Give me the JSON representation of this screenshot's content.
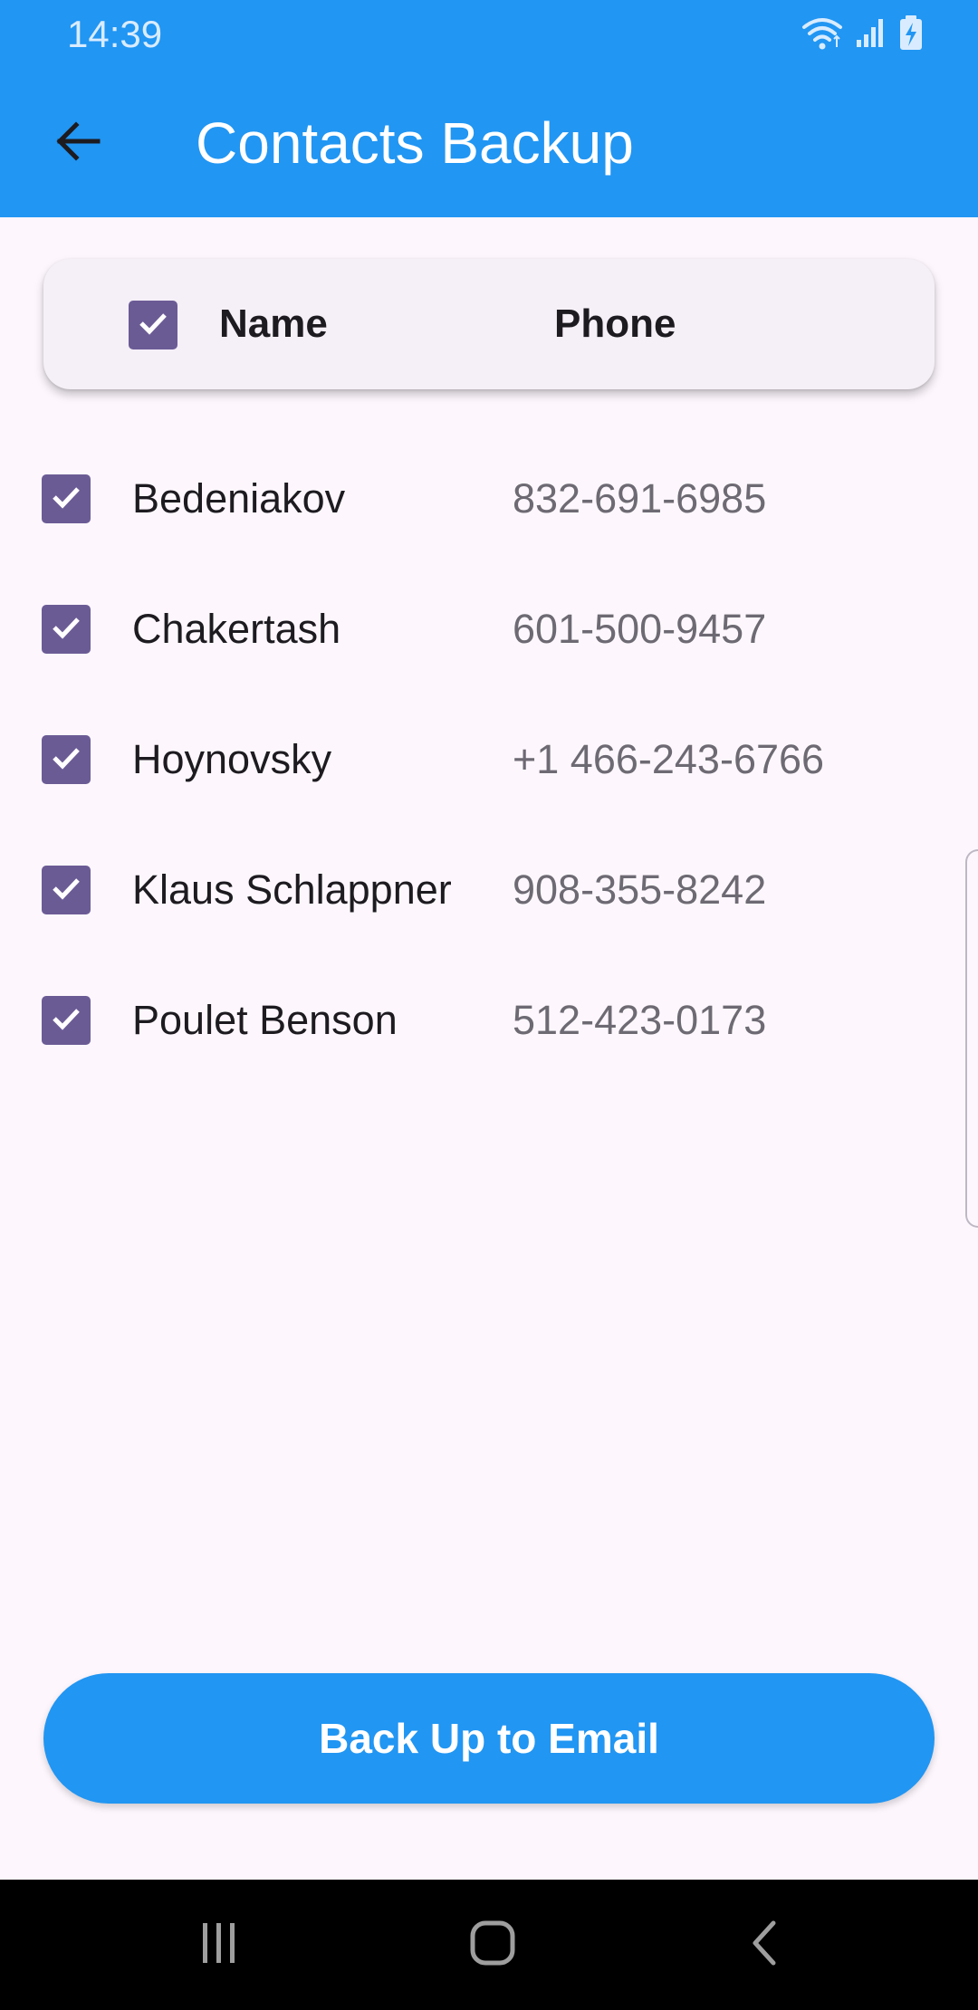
{
  "status_bar": {
    "time": "14:39",
    "icons": [
      "wifi-icon",
      "signal-icon",
      "battery-charging-icon"
    ],
    "color": "#2196f3"
  },
  "app_bar": {
    "title": "Contacts Backup",
    "back_icon": "arrow-back-icon",
    "color": "#2196f3"
  },
  "table": {
    "header": {
      "name_label": "Name",
      "phone_label": "Phone",
      "select_all_checked": true
    },
    "rows": [
      {
        "name": "Bedeniakov",
        "phone": "832-691-6985",
        "checked": true
      },
      {
        "name": "Chakertash",
        "phone": "601-500-9457",
        "checked": true
      },
      {
        "name": "Hoynovsky",
        "phone": "+1 466-243-6766",
        "checked": true
      },
      {
        "name": "Klaus Schlappner",
        "phone": "908-355-8242",
        "checked": true
      },
      {
        "name": "Poulet Benson",
        "phone": "512-423-0173",
        "checked": true
      }
    ],
    "checkbox_color": "#6b5b95"
  },
  "actions": {
    "backup_label": "Back Up to Email",
    "button_color": "#2196f3"
  },
  "nav_bar": {
    "icons": [
      "recents-icon",
      "home-icon",
      "nav-back-icon"
    ]
  }
}
